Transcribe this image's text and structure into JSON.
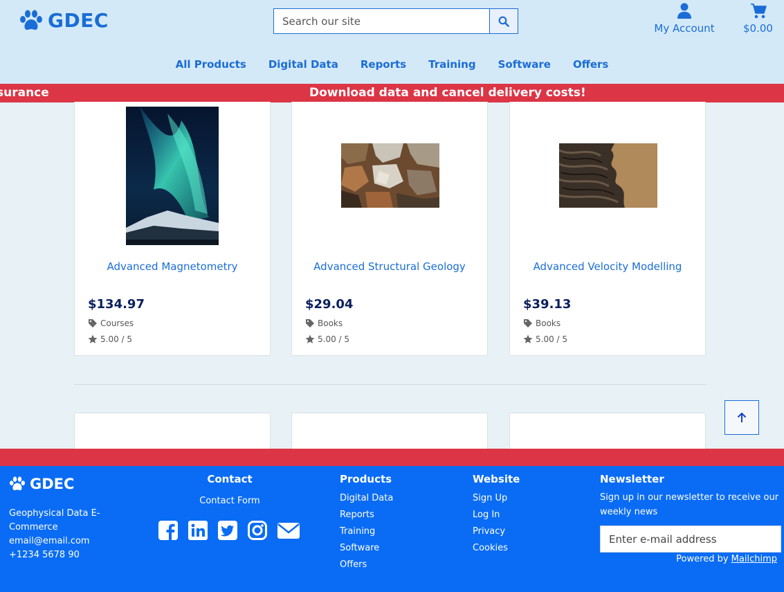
{
  "header": {
    "logo_text": "GDEC",
    "search_placeholder": "Search our site",
    "account_label": "My Account",
    "cart_total": "$0.00"
  },
  "nav": {
    "items": [
      "All Products",
      "Digital Data",
      "Reports",
      "Training",
      "Software",
      "Offers"
    ]
  },
  "marquee": {
    "fragment": "surance",
    "message": "Download data and cancel delivery costs!"
  },
  "products": [
    {
      "title": "Advanced Magnetometry",
      "price": "$134.97",
      "category": "Courses",
      "rating": "5.00 / 5",
      "image": "aurora-image"
    },
    {
      "title": "Advanced Structural Geology",
      "price": "$29.04",
      "category": "Books",
      "rating": "5.00 / 5",
      "image": "rock-texture-image"
    },
    {
      "title": "Advanced Velocity Modelling",
      "price": "$39.13",
      "category": "Books",
      "rating": "5.00 / 5",
      "image": "aerial-terrain-image"
    }
  ],
  "colors": {
    "brand_blue": "#1a6dd6",
    "accent_red": "#dc3545",
    "footer_blue": "#0a6cf5",
    "price_navy": "#0a1f5c"
  },
  "footer": {
    "logo_text": "GDEC",
    "about_name": "Geophysical Data E-Commerce",
    "email": "email@email.com",
    "phone": "+1234 5678 90",
    "contact": {
      "heading": "Contact",
      "form_link": "Contact Form",
      "social_icons": [
        "facebook-icon",
        "linkedin-icon",
        "twitter-icon",
        "instagram-icon",
        "envelope-icon"
      ]
    },
    "products": {
      "heading": "Products",
      "links": [
        "Digital Data",
        "Reports",
        "Training",
        "Software",
        "Offers"
      ]
    },
    "website": {
      "heading": "Website",
      "links": [
        "Sign Up",
        "Log In",
        "Privacy",
        "Cookies"
      ]
    },
    "newsletter": {
      "heading": "Newsletter",
      "text": "Sign up in our newsletter to receive our weekly news",
      "placeholder": "Enter e-mail address",
      "powered_prefix": "Powered by",
      "powered_link": "Mailchimp"
    }
  }
}
